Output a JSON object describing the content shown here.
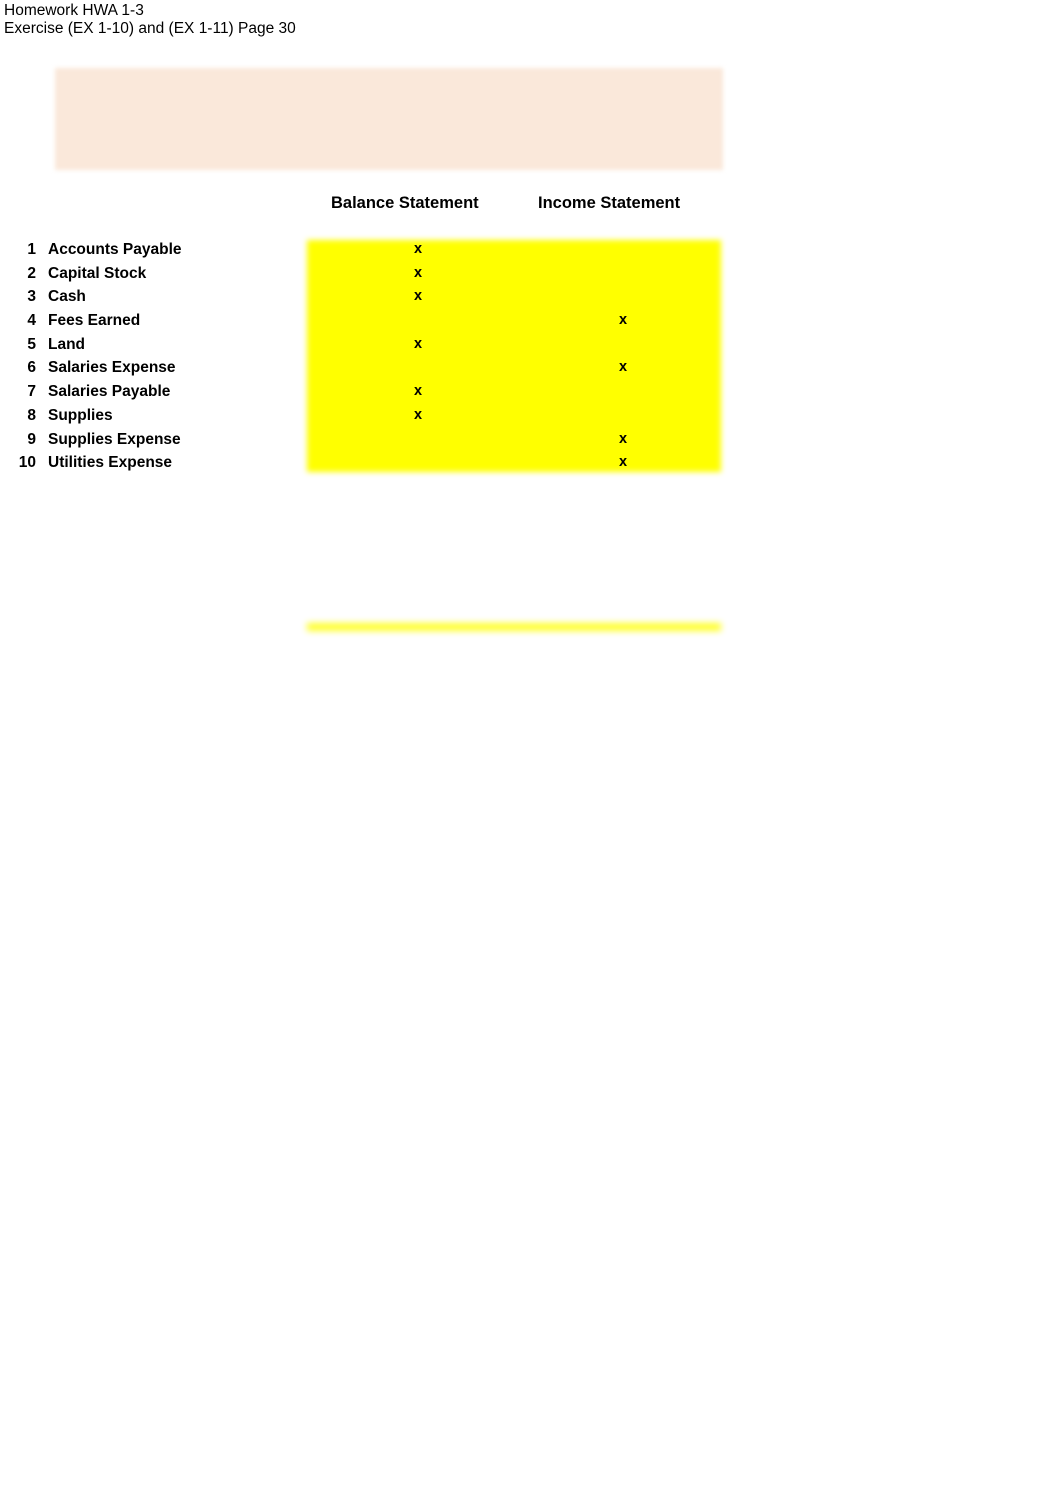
{
  "document": {
    "header_line_1": "Homework HWA 1-3",
    "header_line_2": "Exercise (EX 1-10) and (EX 1-11) Page 30"
  },
  "highlights": {
    "title_band_color": "#fae8da",
    "table_band_color": "#ffff00",
    "title_band_text": ""
  },
  "table": {
    "columns": [
      {
        "key": "balance",
        "label": "Balance Statement"
      },
      {
        "key": "income",
        "label": "Income Statement"
      }
    ],
    "mark_symbol": "x",
    "rows": [
      {
        "num": "1",
        "label": "Accounts Payable",
        "balance": "x",
        "income": ""
      },
      {
        "num": "2",
        "label": "Capital Stock",
        "balance": "x",
        "income": ""
      },
      {
        "num": "3",
        "label": "Cash",
        "balance": "x",
        "income": ""
      },
      {
        "num": "4",
        "label": "Fees Earned",
        "balance": "",
        "income": "x"
      },
      {
        "num": "5",
        "label": "Land",
        "balance": "x",
        "income": ""
      },
      {
        "num": "6",
        "label": "Salaries Expense",
        "balance": "",
        "income": "x"
      },
      {
        "num": "7",
        "label": "Salaries Payable",
        "balance": "x",
        "income": ""
      },
      {
        "num": "8",
        "label": "Supplies",
        "balance": "x",
        "income": ""
      },
      {
        "num": "9",
        "label": "Supplies Expense",
        "balance": "",
        "income": "x"
      },
      {
        "num": "10",
        "label": "Utilities Expense",
        "balance": "",
        "income": "x"
      }
    ]
  }
}
